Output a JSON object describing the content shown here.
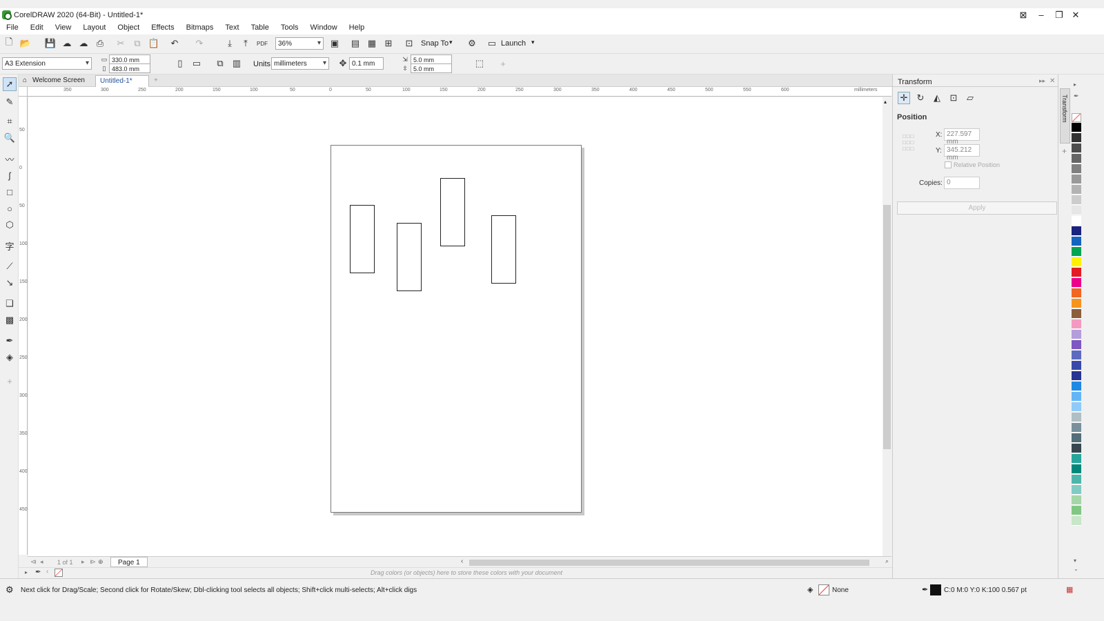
{
  "app": {
    "title": "CorelDRAW 2020 (64-Bit) - Untitled-1*"
  },
  "menu": [
    "File",
    "Edit",
    "View",
    "Layout",
    "Object",
    "Effects",
    "Bitmaps",
    "Text",
    "Table",
    "Tools",
    "Window",
    "Help"
  ],
  "toolbar1": {
    "zoom": "36%",
    "snap_to": "Snap To",
    "launch": "Launch"
  },
  "toolbar2": {
    "page_size": "A3 Extension",
    "width": "330.0 mm",
    "height": "483.0 mm",
    "units_label": "Units:",
    "units": "millimeters",
    "nudge": "0.1 mm",
    "dup_x": "5.0 mm",
    "dup_y": "5.0 mm"
  },
  "tabs": {
    "welcome": "Welcome Screen",
    "doc": "Untitled-1*"
  },
  "ruler": {
    "unit": "millimeters",
    "h_ticks": [
      "350",
      "300",
      "250",
      "200",
      "150",
      "100",
      "50",
      "0",
      "50",
      "100",
      "150",
      "200",
      "250",
      "300",
      "350",
      "400",
      "450",
      "500",
      "550",
      "600"
    ],
    "v_ticks": [
      "50",
      "0",
      "50",
      "100",
      "150",
      "200",
      "250",
      "300",
      "350",
      "400",
      "450",
      "500",
      "550",
      "600"
    ]
  },
  "page_nav": {
    "page_count": "1 of 1",
    "page_tab": "Page 1"
  },
  "color_docker_hint": "Drag colors (or objects) here to store these colors with your document",
  "status": {
    "hint": "Next click for Drag/Scale; Second click for Rotate/Skew; Dbl-clicking tool selects all objects; Shift+click multi-selects; Alt+click digs",
    "fill": "None",
    "outline": "C:0 M:0 Y:0 K:100  0.567 pt"
  },
  "docker": {
    "title": "Transform",
    "section": "Position",
    "x_label": "X:",
    "x_value": "227.597 mm",
    "y_label": "Y:",
    "y_value": "345.212 mm",
    "relative": "Relative Position",
    "copies_label": "Copies:",
    "copies_value": "0",
    "apply": "Apply",
    "side_tab": "Transform"
  },
  "palette": [
    "#000000",
    "#333333",
    "#4d4d4d",
    "#666666",
    "#808080",
    "#999999",
    "#b3b3b3",
    "#cccccc",
    "#e6e6e6",
    "#ffffff",
    "#1a237e",
    "#1565c0",
    "#00a651",
    "#fff200",
    "#e31c23",
    "#ec008c",
    "#f26522",
    "#f7941d",
    "#8b5e3c",
    "#f49ac1",
    "#b39ddb",
    "#7e57c2",
    "#5c6bc0",
    "#3949ab",
    "#283593",
    "#1e88e5",
    "#64b5f6",
    "#90caf9",
    "#b0bec5",
    "#78909c",
    "#546e7a",
    "#37474f",
    "#26a69a",
    "#00897b",
    "#4db6ac",
    "#80cbc4",
    "#a5d6a7",
    "#81c784",
    "#c8e6c9"
  ]
}
